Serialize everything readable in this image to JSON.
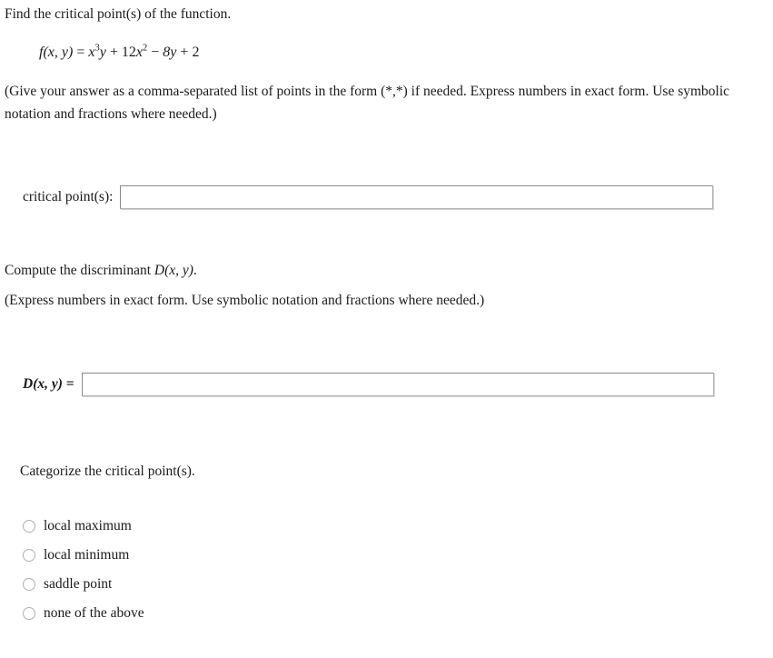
{
  "question": {
    "prompt": "Find the critical point(s) of the function.",
    "formula": {
      "lhs": "f(x, y)",
      "equals": "=",
      "term1_base": "x",
      "term1_exp": "3",
      "term1_var": "y",
      "op1": "+",
      "term2_coef": "12",
      "term2_base": "x",
      "term2_exp": "2",
      "op2": "−",
      "term3": "8y",
      "op3": "+",
      "term4": "2",
      "plain": "f(x, y) = x³ y + 12x² − 8 y + 2"
    },
    "instruction": "(Give your answer as a comma-separated list of points in the form (*,*) if needed. Express numbers in exact form. Use symbolic notation and fractions where needed.)"
  },
  "critical_points": {
    "label": "critical point(s):",
    "value": "",
    "placeholder": ""
  },
  "discriminant": {
    "title_prefix": "Compute the discriminant ",
    "title_math": "D(x, y)",
    "title_suffix": ".",
    "note": "(Express numbers in exact form. Use symbolic notation and fractions where needed.)",
    "label": "D(x, y) =",
    "value": "",
    "placeholder": ""
  },
  "categorize": {
    "title": "Categorize the critical point(s).",
    "selected": null,
    "options": [
      {
        "label": "local maximum",
        "checked": false
      },
      {
        "label": "local minimum",
        "checked": false
      },
      {
        "label": "saddle point",
        "checked": false
      },
      {
        "label": "none of the above",
        "checked": false
      }
    ]
  },
  "colors": {
    "page_background": "#ffffff",
    "text": "#1a1a1a",
    "input_border": "#8a8a8a",
    "input_shadow": "#cfcfcf",
    "radio_border": "#b0b0b0"
  }
}
